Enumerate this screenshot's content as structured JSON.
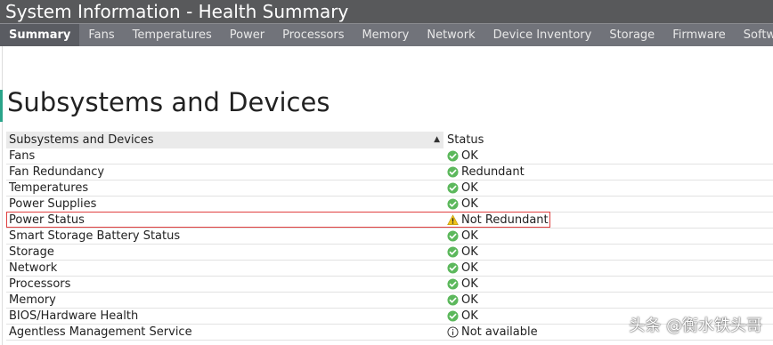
{
  "window": {
    "title": "System Information - Health Summary"
  },
  "tabs": [
    {
      "label": "Summary",
      "active": true
    },
    {
      "label": "Fans"
    },
    {
      "label": "Temperatures"
    },
    {
      "label": "Power"
    },
    {
      "label": "Processors"
    },
    {
      "label": "Memory"
    },
    {
      "label": "Network"
    },
    {
      "label": "Device Inventory"
    },
    {
      "label": "Storage"
    },
    {
      "label": "Firmware"
    },
    {
      "label": "Software"
    }
  ],
  "page": {
    "heading": "Subsystems and Devices"
  },
  "table": {
    "col1_header": "Subsystems and Devices",
    "col2_header": "Status",
    "rows": [
      {
        "name": "Fans",
        "status": "OK",
        "icon": "ok-check-icon"
      },
      {
        "name": "Fan Redundancy",
        "status": "Redundant",
        "icon": "ok-check-icon"
      },
      {
        "name": "Temperatures",
        "status": "OK",
        "icon": "ok-check-icon"
      },
      {
        "name": "Power Supplies",
        "status": "OK",
        "icon": "ok-check-icon"
      },
      {
        "name": "Power Status",
        "status": "Not Redundant",
        "icon": "warning-icon"
      },
      {
        "name": "Smart Storage Battery Status",
        "status": "OK",
        "icon": "ok-check-icon"
      },
      {
        "name": "Storage",
        "status": "OK",
        "icon": "ok-check-icon"
      },
      {
        "name": "Network",
        "status": "OK",
        "icon": "ok-check-icon"
      },
      {
        "name": "Processors",
        "status": "OK",
        "icon": "ok-check-icon"
      },
      {
        "name": "Memory",
        "status": "OK",
        "icon": "ok-check-icon"
      },
      {
        "name": "BIOS/Hardware Health",
        "status": "OK",
        "icon": "ok-check-icon"
      },
      {
        "name": "Agentless Management Service",
        "status": "Not available",
        "icon": "info-icon"
      }
    ]
  },
  "watermark": "头条 @衡水铁头哥",
  "colors": {
    "titlebar": "#58595b",
    "tabbar": "#71737a",
    "ok": "#5cb85c",
    "warning": "#f0c419",
    "highlight_border": "#e04040",
    "accent": "#2aa48a"
  }
}
